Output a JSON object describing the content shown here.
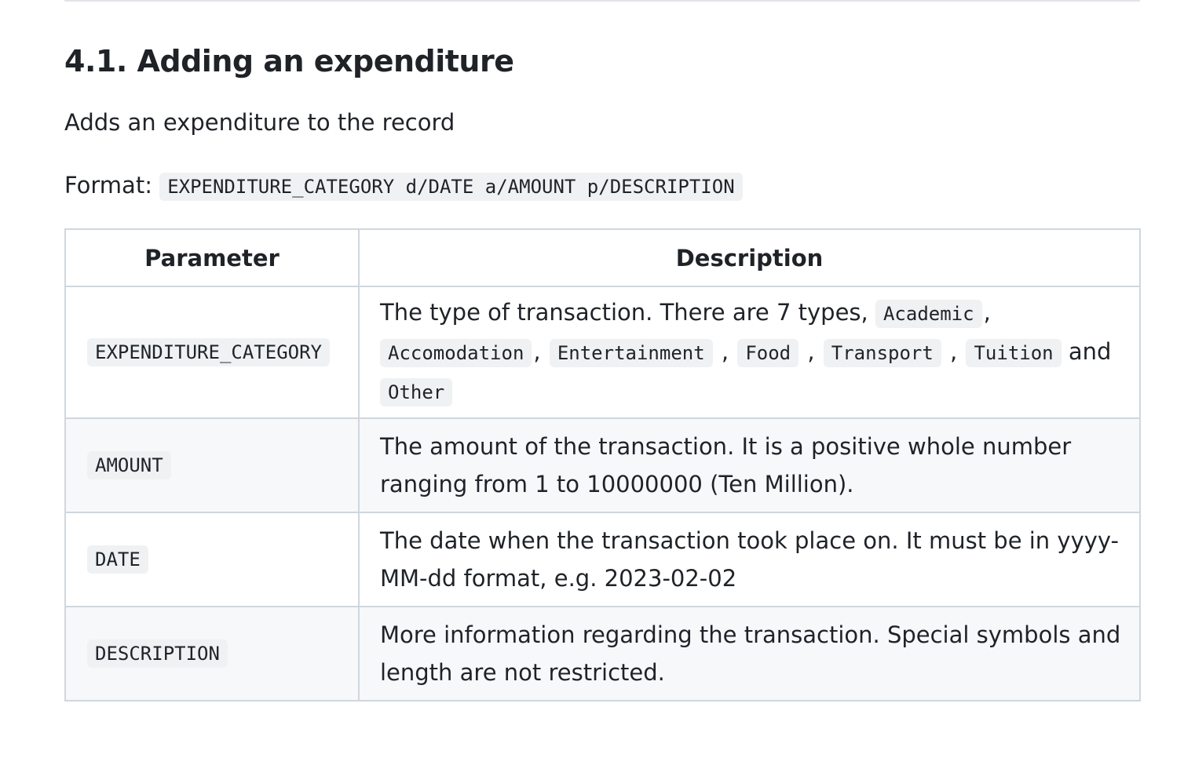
{
  "section": {
    "title": "4.1. Adding an expenditure",
    "summary": "Adds an expenditure to the record",
    "format_label": "Format:",
    "format_code": "EXPENDITURE_CATEGORY d/DATE a/AMOUNT p/DESCRIPTION"
  },
  "table": {
    "headers": [
      "Parameter",
      "Description"
    ],
    "rows": [
      {
        "param": "EXPENDITURE_CATEGORY",
        "description_intro": "The type of transaction. There are 7 types,",
        "types": [
          "Academic",
          "Accomodation",
          "Entertainment",
          "Food",
          "Transport",
          "Tuition",
          "Other"
        ],
        "joiner_comma": ",",
        "joiner_and": "and"
      },
      {
        "param": "AMOUNT",
        "description": "The amount of the transaction. It is a positive whole number ranging from 1 to 10000000 (Ten Million)."
      },
      {
        "param": "DATE",
        "description": "The date when the transaction took place on. It must be in yyyy-MM-dd format, e.g. 2023-02-02"
      },
      {
        "param": "DESCRIPTION",
        "description": "More information regarding the transaction. Special symbols and length are not restricted."
      }
    ]
  }
}
